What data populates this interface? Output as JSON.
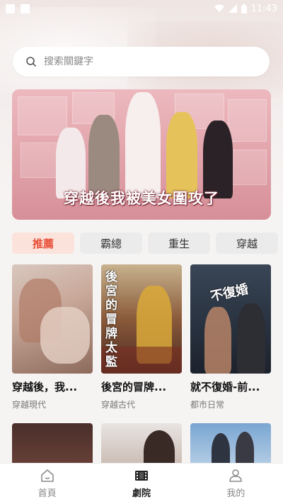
{
  "status_bar": {
    "time": "11:43"
  },
  "search": {
    "placeholder": "搜索關鍵字"
  },
  "banner": {
    "title": "穿越後我被美女圍攻了"
  },
  "tabs": [
    {
      "label": "推薦",
      "active": true
    },
    {
      "label": "霸總",
      "active": false
    },
    {
      "label": "重生",
      "active": false
    },
    {
      "label": "穿越",
      "active": false
    }
  ],
  "dramas": [
    {
      "title": "穿越後，我...",
      "tag": "穿越現代",
      "poster_text": ""
    },
    {
      "title": "後宮的冒牌...",
      "tag": "穿越古代",
      "poster_text": "後宮的冒牌太監"
    },
    {
      "title": "就不復婚-前...",
      "tag": "都市日常",
      "poster_text": "不復婚"
    },
    {
      "title": "",
      "tag": "",
      "poster_text": ""
    },
    {
      "title": "",
      "tag": "",
      "poster_text": ""
    },
    {
      "title": "",
      "tag": "",
      "poster_text": ""
    }
  ],
  "bottom_nav": [
    {
      "label": "首頁",
      "icon": "home-icon",
      "active": false
    },
    {
      "label": "劇院",
      "icon": "film-icon",
      "active": true
    },
    {
      "label": "我的",
      "icon": "profile-icon",
      "active": false
    }
  ],
  "colors": {
    "accent": "#e8503a",
    "active_tab_bg": "#fbe3dc",
    "banner_pink": "#e2a4ab"
  }
}
